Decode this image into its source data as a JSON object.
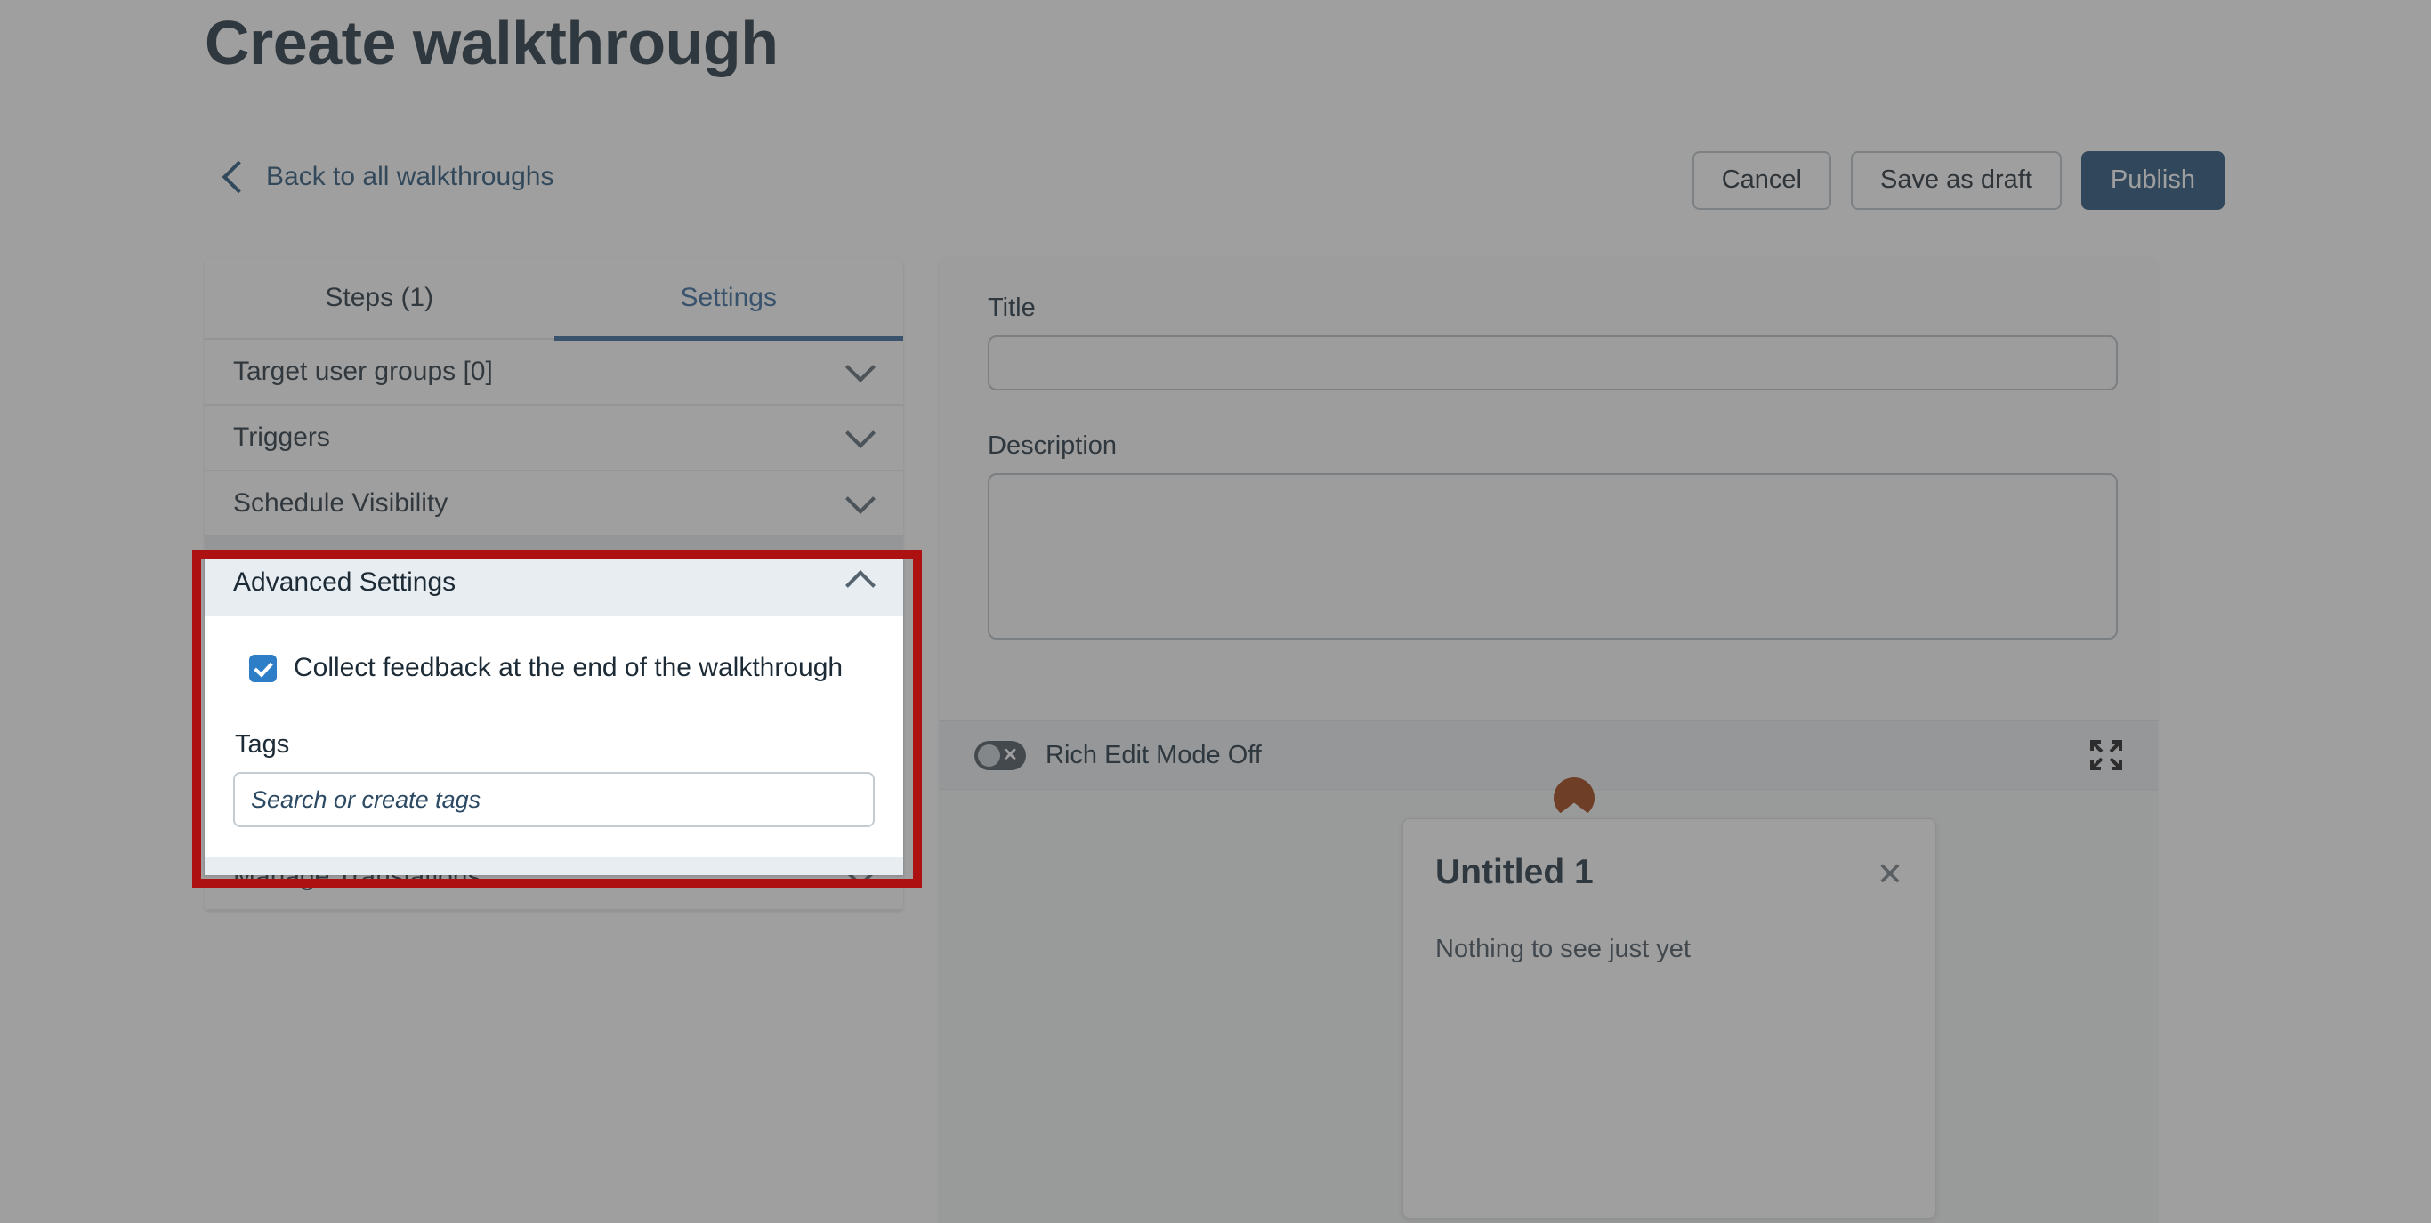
{
  "header": {
    "page_title": "Create walkthrough",
    "back_link": "Back to all walkthroughs",
    "back_icon": "chevron-left-icon",
    "buttons": {
      "cancel": "Cancel",
      "save_draft": "Save as draft",
      "publish": "Publish"
    },
    "accent_primary": "#1b4a74"
  },
  "sidebar": {
    "tabs": [
      {
        "label": "Steps (1)",
        "active": false
      },
      {
        "label": "Settings",
        "active": true
      }
    ],
    "sections": [
      {
        "label": "Target user groups [0]",
        "icon": "chevron-down-icon",
        "open": false
      },
      {
        "label": "Triggers",
        "icon": "chevron-down-icon",
        "open": false
      },
      {
        "label": "Schedule Visibility",
        "icon": "chevron-down-icon",
        "open": false
      },
      {
        "label": "Advanced Settings",
        "icon": "chevron-up-icon",
        "open": true
      },
      {
        "label": "Manage Translations",
        "icon": "chevron-down-icon",
        "open": false
      }
    ],
    "advanced": {
      "checkbox_label": "Collect feedback at the end of the walkthrough",
      "checkbox_checked": true,
      "checkbox_color": "#2d7dc7",
      "tags_label": "Tags",
      "tags_value": "",
      "tags_placeholder": "Search or create tags"
    }
  },
  "preview": {
    "title_label": "Title",
    "title_value": "",
    "description_label": "Description",
    "description_value": "",
    "rich_edit": {
      "label": "Rich Edit Mode Off",
      "toggle_state": "off",
      "toggle_icon": "toggle-off-icon",
      "expand_icon": "expand-fullscreen-icon"
    },
    "card": {
      "title": "Untitled 1",
      "body": "Nothing to see just yet",
      "close_icon": "close-icon",
      "beacon_icon": "beacon-marker-icon",
      "beacon_color": "#9b3503"
    }
  },
  "highlight": {
    "color": "#ad1111",
    "target": "Advanced Settings"
  }
}
